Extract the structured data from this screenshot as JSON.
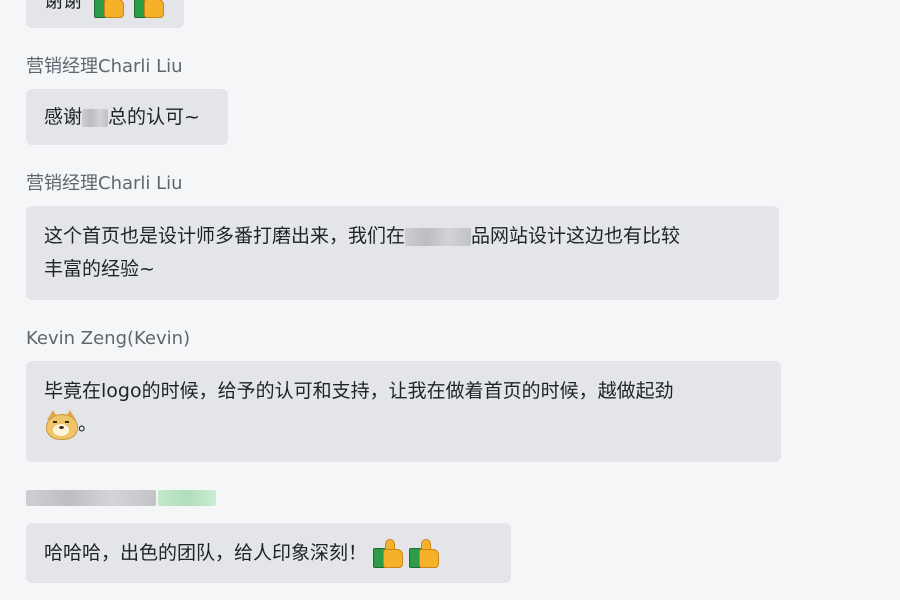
{
  "messages": [
    {
      "sender": "",
      "text_before": "谢谢",
      "text_after": "",
      "emojis": [
        "thumbs-up-icon",
        "thumbs-up-icon"
      ]
    },
    {
      "sender": "营销经理Charli Liu",
      "text_before": "感谢",
      "text_after": "总的认可~"
    },
    {
      "sender": "营销经理Charli Liu",
      "line1_before": "这个首页也是设计师多番打磨出来，我们在",
      "line1_after": "品网站设计这边也有比较",
      "line2": "丰富的经验~"
    },
    {
      "sender": "Kevin Zeng(Kevin)",
      "line1": "毕竟在logo的时候，给予的认可和支持，让我在做着首页的时候，越做起劲",
      "line2_after": "。",
      "emoji": "doge-icon"
    },
    {
      "sender": "",
      "text": "哈哈哈，出色的团队，给人印象深刻！",
      "emojis": [
        "thumbs-up-icon",
        "thumbs-up-icon"
      ]
    }
  ],
  "colors": {
    "background": "#f5f6f7",
    "bubble": "#e3e5e8",
    "sender_text": "#5f6670",
    "body_text": "#1f2329"
  }
}
